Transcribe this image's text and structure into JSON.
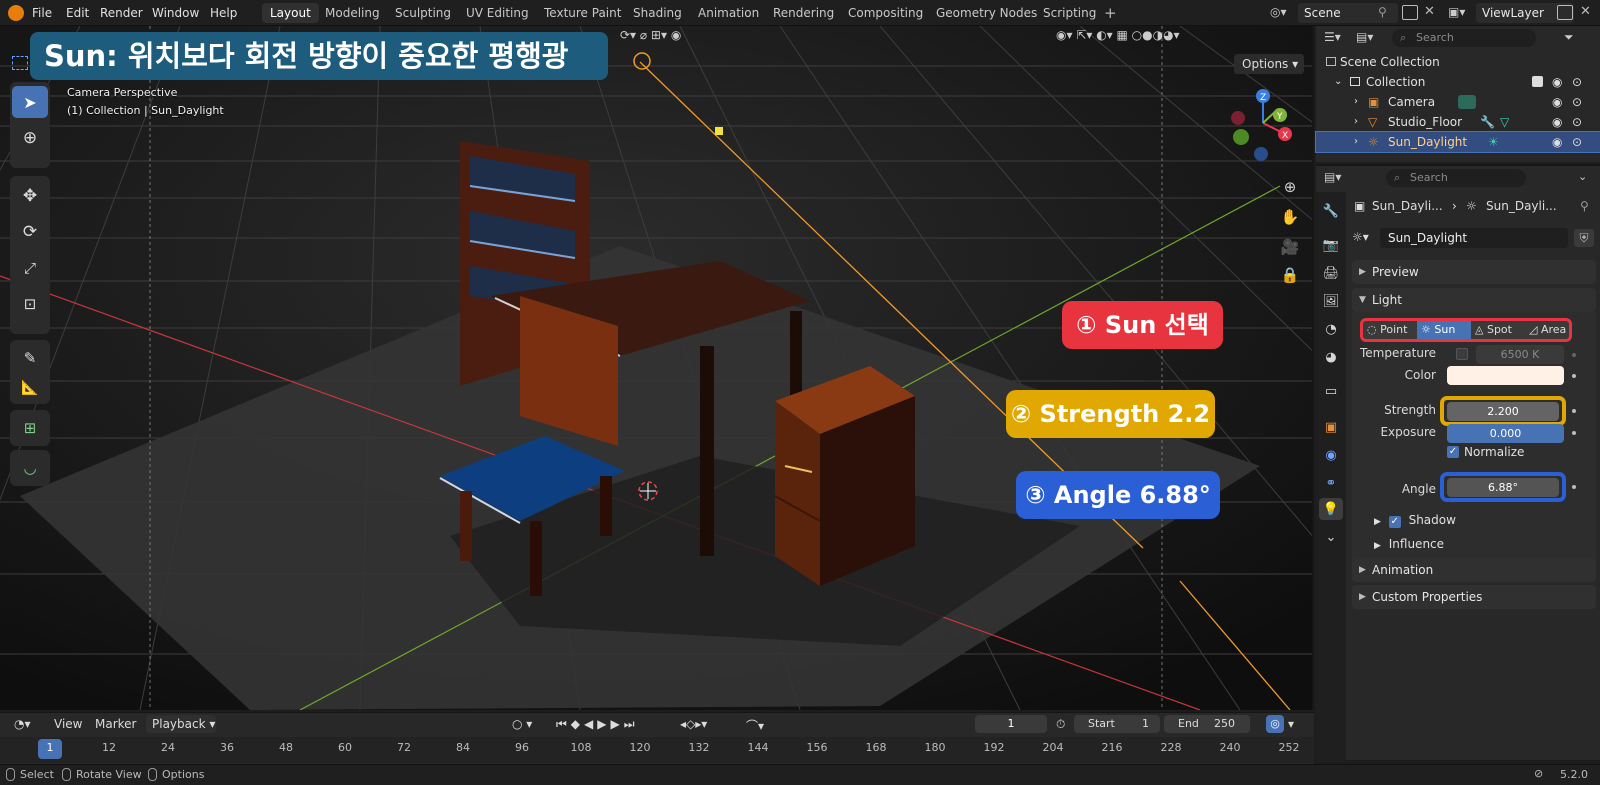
{
  "menu": {
    "items": [
      "File",
      "Edit",
      "Render",
      "Window",
      "Help"
    ]
  },
  "workspaces": {
    "tabs": [
      "Layout",
      "Modeling",
      "Sculpting",
      "UV Editing",
      "Texture Paint",
      "Shading",
      "Animation",
      "Rendering",
      "Compositing",
      "Geometry Nodes",
      "Scripting"
    ],
    "active": "Layout"
  },
  "scene": {
    "name": "Scene",
    "view_layer": "ViewLayer"
  },
  "viewport": {
    "camera_label": "Camera Perspective",
    "collection_label": "(1) Collection | Sun_Daylight",
    "options_label": "Options"
  },
  "annotations": {
    "title": "Sun: 위치보다 회전 방향이 중요한 평행광",
    "callout1": "① Sun 선택",
    "callout2": "② Strength 2.2",
    "callout3": "③ Angle 6.88°",
    "color_red": "#e8343f",
    "color_yellow": "#e0a800",
    "color_blue": "#2a5fd6",
    "color_title": "#1e5c7d"
  },
  "outliner": {
    "search_placeholder": "Search",
    "scene_collection": "Scene Collection",
    "collection": "Collection",
    "items": [
      "Camera",
      "Studio_Floor",
      "Sun_Daylight"
    ],
    "selected": "Sun_Daylight"
  },
  "properties": {
    "search_placeholder": "Search",
    "breadcrumb_object": "Sun_Dayli...",
    "breadcrumb_data": "Sun_Dayli...",
    "datablock_name": "Sun_Daylight",
    "panels": {
      "preview": "Preview",
      "light": "Light",
      "shadow": "Shadow",
      "influence": "Influence",
      "animation": "Animation",
      "custom_properties": "Custom Properties"
    },
    "light_types": [
      "Point",
      "Sun",
      "Spot",
      "Area"
    ],
    "light_type_selected": "Sun",
    "temperature_label": "Temperature",
    "temperature_value": "6500 K",
    "color_label": "Color",
    "color_value": "#fff1e6",
    "strength_label": "Strength",
    "strength_value": "2.200",
    "exposure_label": "Exposure",
    "exposure_value": "0.000",
    "normalize_label": "Normalize",
    "angle_label": "Angle",
    "angle_value": "6.88°"
  },
  "timeline": {
    "view": "View",
    "marker": "Marker",
    "playback": "Playback",
    "current_frame": "1",
    "start_label": "Start",
    "start_value": "1",
    "end_label": "End",
    "end_value": "250",
    "ruler": [
      "1",
      "12",
      "24",
      "36",
      "48",
      "60",
      "72",
      "84",
      "96",
      "108",
      "120",
      "132",
      "144",
      "156",
      "168",
      "180",
      "192",
      "204",
      "216",
      "228",
      "240",
      "252"
    ]
  },
  "statusbar": {
    "select": "Select",
    "rotate_view": "Rotate View",
    "options": "Options",
    "version": "5.2.0"
  }
}
